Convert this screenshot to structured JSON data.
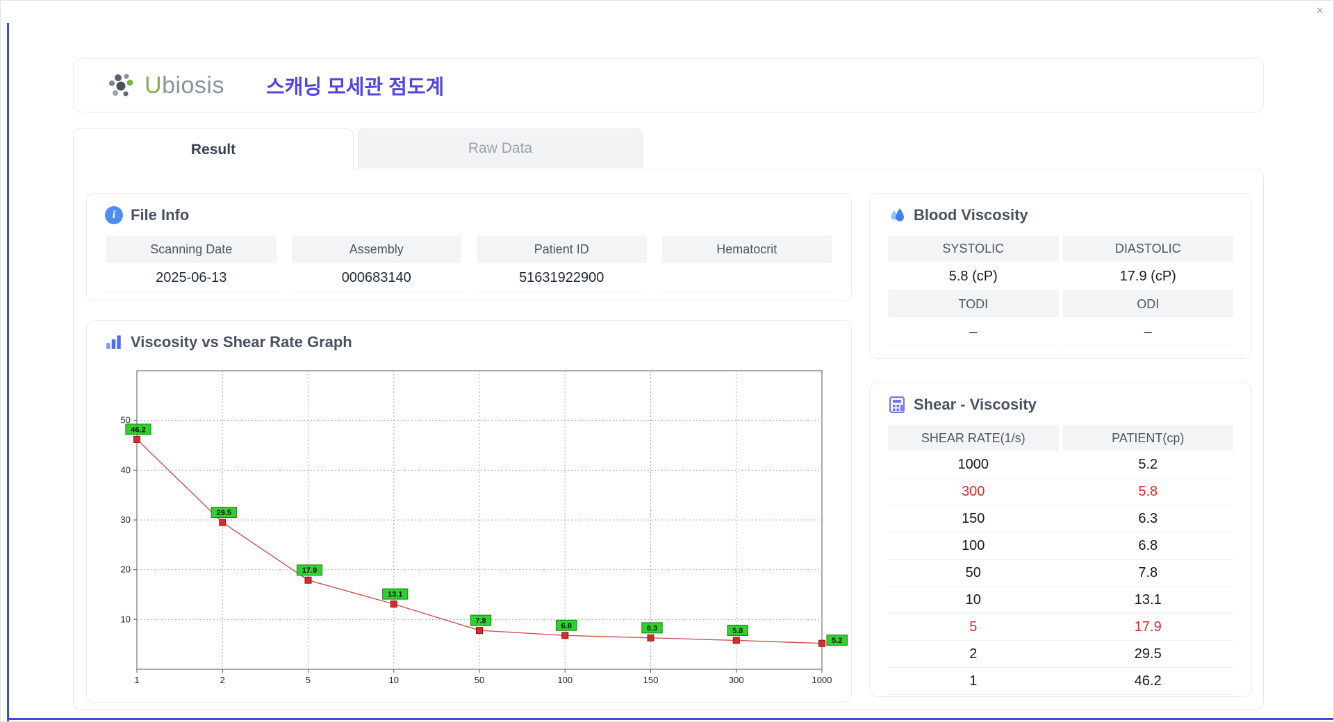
{
  "window": {
    "close_icon": "×"
  },
  "header": {
    "logo_u": "U",
    "logo_rest": "biosis",
    "title": "스캐닝 모세관 점도계"
  },
  "tabs": [
    {
      "label": "Result",
      "active": true
    },
    {
      "label": "Raw Data",
      "active": false
    }
  ],
  "file_info": {
    "heading": "File Info",
    "fields": [
      {
        "label": "Scanning Date",
        "value": "2025-06-13"
      },
      {
        "label": "Assembly",
        "value": "000683140"
      },
      {
        "label": "Patient ID",
        "value": "51631922900"
      },
      {
        "label": "Hematocrit",
        "value": ""
      }
    ]
  },
  "blood_viscosity": {
    "heading": "Blood Viscosity",
    "cells": [
      {
        "label": "SYSTOLIC",
        "value": "5.8 (cP)"
      },
      {
        "label": "DIASTOLIC",
        "value": "17.9 (cP)"
      },
      {
        "label": "TODI",
        "value": "–"
      },
      {
        "label": "ODI",
        "value": "–"
      }
    ]
  },
  "shear_viscosity": {
    "heading": "Shear - Viscosity",
    "columns": [
      "SHEAR RATE(1/s)",
      "PATIENT(cp)"
    ],
    "rows": [
      {
        "shear": "1000",
        "patient": "5.2",
        "highlight": false
      },
      {
        "shear": "300",
        "patient": "5.8",
        "highlight": true
      },
      {
        "shear": "150",
        "patient": "6.3",
        "highlight": false
      },
      {
        "shear": "100",
        "patient": "6.8",
        "highlight": false
      },
      {
        "shear": "50",
        "patient": "7.8",
        "highlight": false
      },
      {
        "shear": "10",
        "patient": "13.1",
        "highlight": false
      },
      {
        "shear": "5",
        "patient": "17.9",
        "highlight": true
      },
      {
        "shear": "2",
        "patient": "29.5",
        "highlight": false
      },
      {
        "shear": "1",
        "patient": "46.2",
        "highlight": false
      }
    ]
  },
  "chart": {
    "heading": "Viscosity vs Shear Rate Graph"
  },
  "chart_data": {
    "type": "line",
    "title": "Viscosity vs Shear Rate Graph",
    "categories": [
      "1",
      "2",
      "5",
      "10",
      "50",
      "100",
      "150",
      "300",
      "1000"
    ],
    "values": [
      46.2,
      29.5,
      17.9,
      13.1,
      7.8,
      6.8,
      6.3,
      5.8,
      5.2
    ],
    "xlabel": "",
    "ylabel": "",
    "ylim": [
      0,
      60
    ],
    "yticks": [
      10,
      20,
      30,
      40,
      50
    ],
    "grid": true,
    "legend": false,
    "line_color": "#d05050",
    "marker_color": "#d62c2c",
    "marker_border": "#8f1414",
    "label_bg": "#2fd12f",
    "label_border": "#1a7a1a"
  },
  "colors": {
    "accent_blue": "#3450d6",
    "title_indigo": "#4f46e5",
    "highlight_red": "#d92b2b",
    "header_gray": "#f3f4f6"
  }
}
